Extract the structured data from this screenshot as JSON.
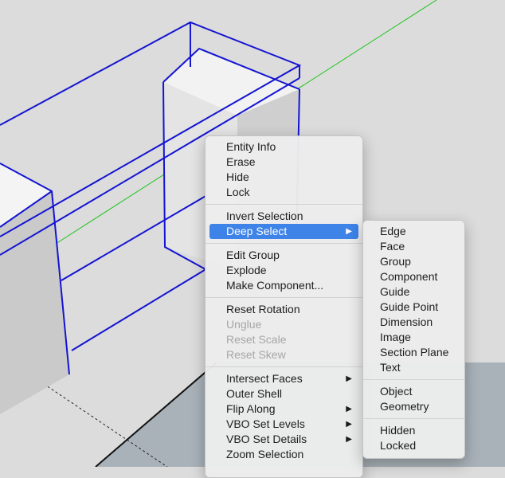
{
  "colors": {
    "background": "#dcdcdc",
    "selection_edge": "#1414d2",
    "green_axis": "#18c418",
    "menu_highlight": "#3e83e8"
  },
  "context_menu": {
    "groups": [
      [
        {
          "label": "Entity Info"
        },
        {
          "label": "Erase"
        },
        {
          "label": "Hide"
        },
        {
          "label": "Lock"
        }
      ],
      [
        {
          "label": "Invert Selection"
        },
        {
          "label": "Deep Select",
          "submenu": true,
          "active": true
        }
      ],
      [
        {
          "label": "Edit Group"
        },
        {
          "label": "Explode"
        },
        {
          "label": "Make Component..."
        }
      ],
      [
        {
          "label": "Reset Rotation"
        },
        {
          "label": "Unglue",
          "disabled": true
        },
        {
          "label": "Reset Scale",
          "disabled": true
        },
        {
          "label": "Reset Skew",
          "disabled": true
        }
      ],
      [
        {
          "label": "Intersect Faces",
          "submenu": true
        },
        {
          "label": "Outer Shell"
        },
        {
          "label": "Flip Along",
          "submenu": true
        },
        {
          "label": "VBO Set Levels",
          "submenu": true
        },
        {
          "label": "VBO Set Details",
          "submenu": true
        },
        {
          "label": "Zoom Selection"
        }
      ]
    ]
  },
  "deep_select_submenu": {
    "groups": [
      [
        {
          "label": "Edge"
        },
        {
          "label": "Face"
        },
        {
          "label": "Group"
        },
        {
          "label": "Component"
        },
        {
          "label": "Guide"
        },
        {
          "label": "Guide Point"
        },
        {
          "label": "Dimension"
        },
        {
          "label": "Image"
        },
        {
          "label": "Section Plane"
        },
        {
          "label": "Text"
        }
      ],
      [
        {
          "label": "Object"
        },
        {
          "label": "Geometry"
        }
      ],
      [
        {
          "label": "Hidden"
        },
        {
          "label": "Locked"
        }
      ]
    ]
  }
}
